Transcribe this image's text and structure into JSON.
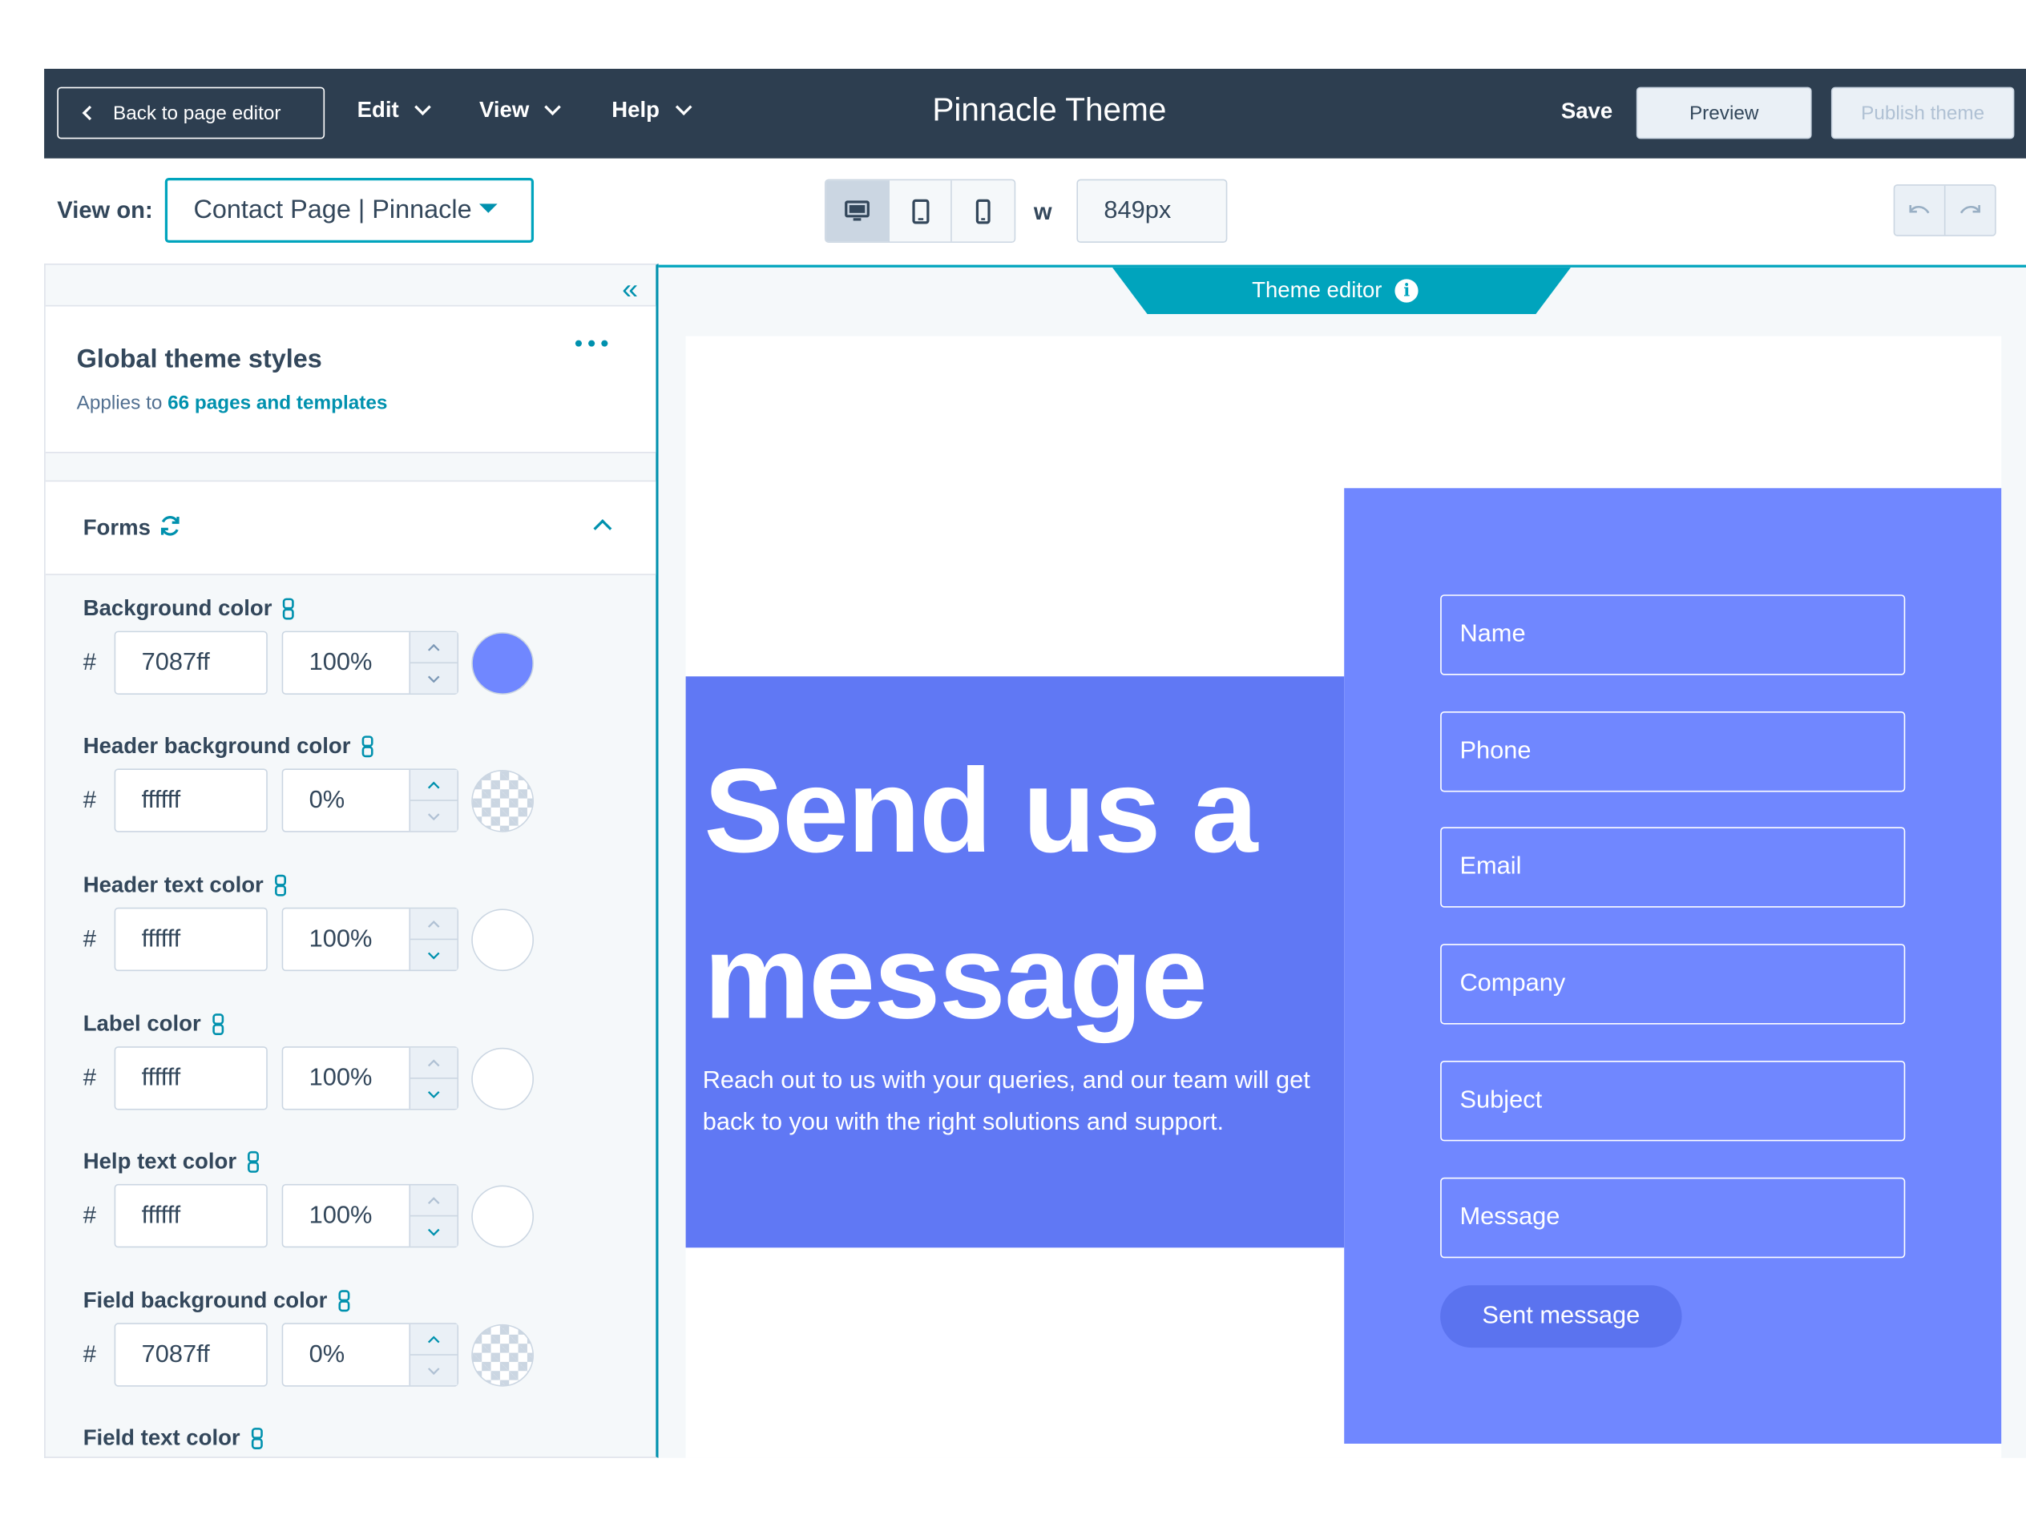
{
  "topbar": {
    "back_label": "Back to page editor",
    "menus": [
      "Edit",
      "View",
      "Help"
    ],
    "title": "Pinnacle Theme",
    "save_label": "Save",
    "preview_label": "Preview",
    "publish_label": "Publish theme"
  },
  "toolbar": {
    "view_on_label": "View on:",
    "view_on_value": "Contact Page | Pinnacle",
    "width_label": "w",
    "width_value": "849px",
    "devices": [
      "desktop-icon",
      "tablet-icon",
      "mobile-icon"
    ]
  },
  "sidebar": {
    "card_title": "Global theme styles",
    "card_sub_prefix": "Applies to",
    "card_sub_link": "66 pages and templates",
    "section_title": "Forms",
    "fields": [
      {
        "label": "Background color",
        "hex": "7087ff",
        "opacity": "100%",
        "swatch": "#7087ff"
      },
      {
        "label": "Header background color",
        "hex": "ffffff",
        "opacity": "0%",
        "swatch": "transparent"
      },
      {
        "label": "Header text color",
        "hex": "ffffff",
        "opacity": "100%",
        "swatch": "#ffffff"
      },
      {
        "label": "Label color",
        "hex": "ffffff",
        "opacity": "100%",
        "swatch": "#ffffff"
      },
      {
        "label": "Help text color",
        "hex": "ffffff",
        "opacity": "100%",
        "swatch": "#ffffff"
      },
      {
        "label": "Field background color",
        "hex": "7087ff",
        "opacity": "0%",
        "swatch": "transparent"
      },
      {
        "label": "Field text color"
      }
    ]
  },
  "canvas": {
    "tab_label": "Theme editor",
    "hero_title": "Send us a message",
    "hero_text": "Reach out to us with your queries, and our team will get back to you with the right solutions and support.",
    "form_fields": [
      "Name",
      "Phone",
      "Email",
      "Company",
      "Subject",
      "Message"
    ],
    "submit_label": "Sent message"
  },
  "colors": {
    "topbar": "#2d3e50",
    "accent": "#00a4bd",
    "hero_bg": "#6078f4",
    "form_bg": "#7087ff",
    "submit_bg": "#5b73ef"
  }
}
